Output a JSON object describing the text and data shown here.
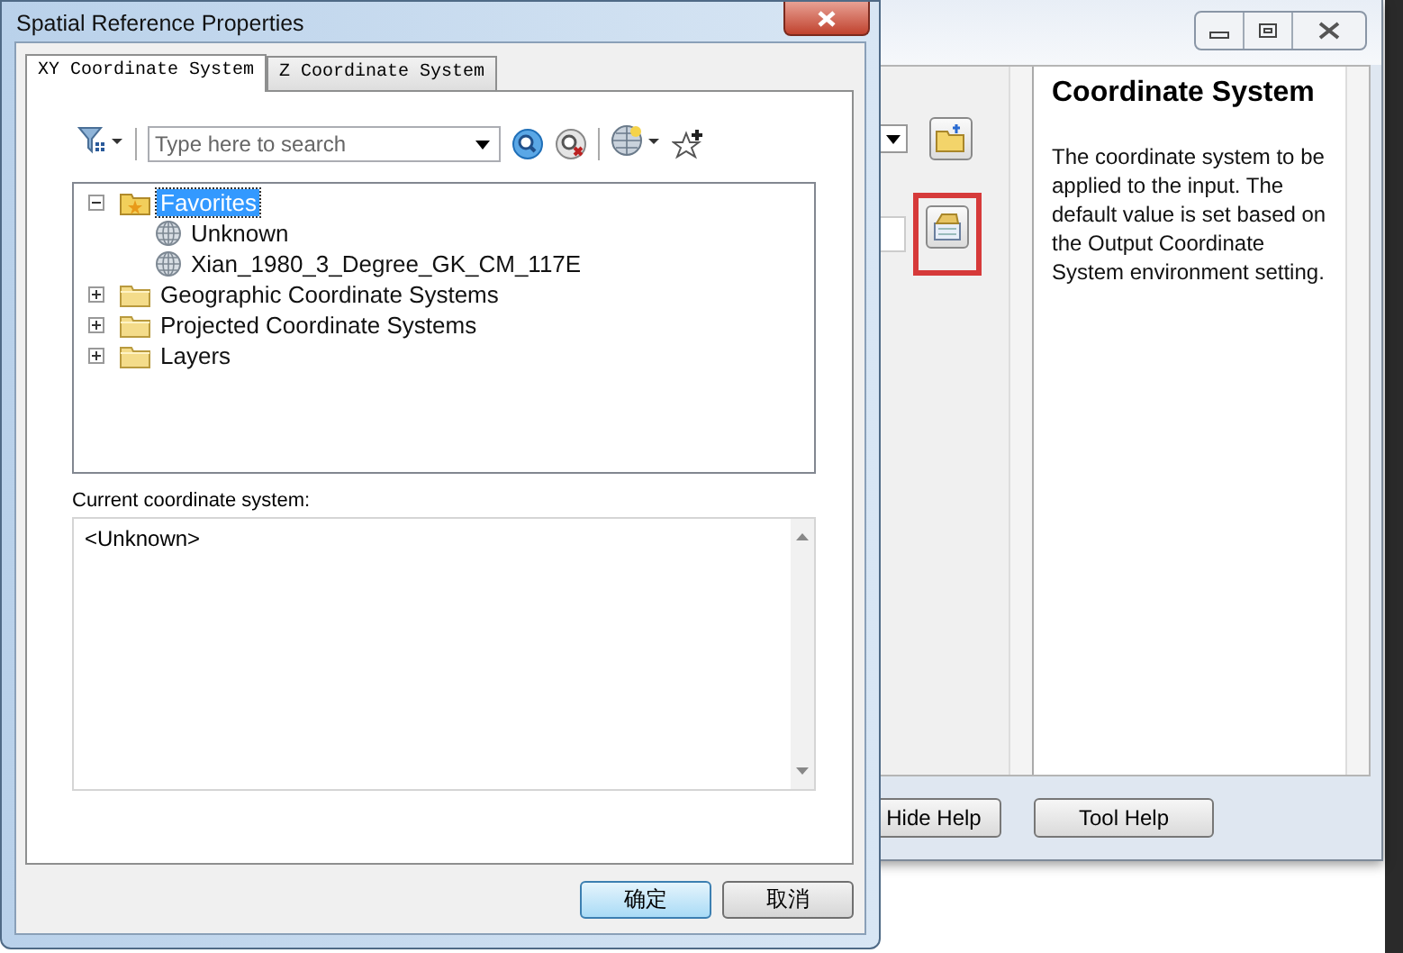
{
  "background_window": {
    "help_title": "Coordinate System",
    "help_text": "The coordinate system to be applied to the input. The default value is set based on the Output Coordinate System environment setting.",
    "buttons": [
      {
        "label": "Hide Help"
      },
      {
        "label": "Tool Help"
      }
    ]
  },
  "dialog": {
    "title": "Spatial Reference Properties",
    "tabs": [
      {
        "label": "XY Coordinate System",
        "selected": true
      },
      {
        "label": "Z Coordinate System",
        "selected": false
      }
    ],
    "search": {
      "placeholder": "Type here to search"
    },
    "tree": [
      {
        "label": "Favorites",
        "kind": "favorites",
        "expanded": true,
        "selected": true,
        "children": [
          {
            "label": "Unknown",
            "kind": "crs",
            "selected": false
          },
          {
            "label": "Xian_1980_3_Degree_GK_CM_117E",
            "kind": "crs",
            "selected": false
          }
        ]
      },
      {
        "label": "Geographic Coordinate Systems",
        "kind": "folder",
        "expanded": false,
        "selected": false
      },
      {
        "label": "Projected Coordinate Systems",
        "kind": "folder",
        "expanded": false,
        "selected": false
      },
      {
        "label": "Layers",
        "kind": "folder",
        "expanded": false,
        "selected": false
      }
    ],
    "current_label": "Current coordinate system:",
    "current_value": "<Unknown>",
    "buttons": [
      {
        "label": "确定",
        "default": true
      },
      {
        "label": "取消",
        "default": false
      }
    ]
  }
}
